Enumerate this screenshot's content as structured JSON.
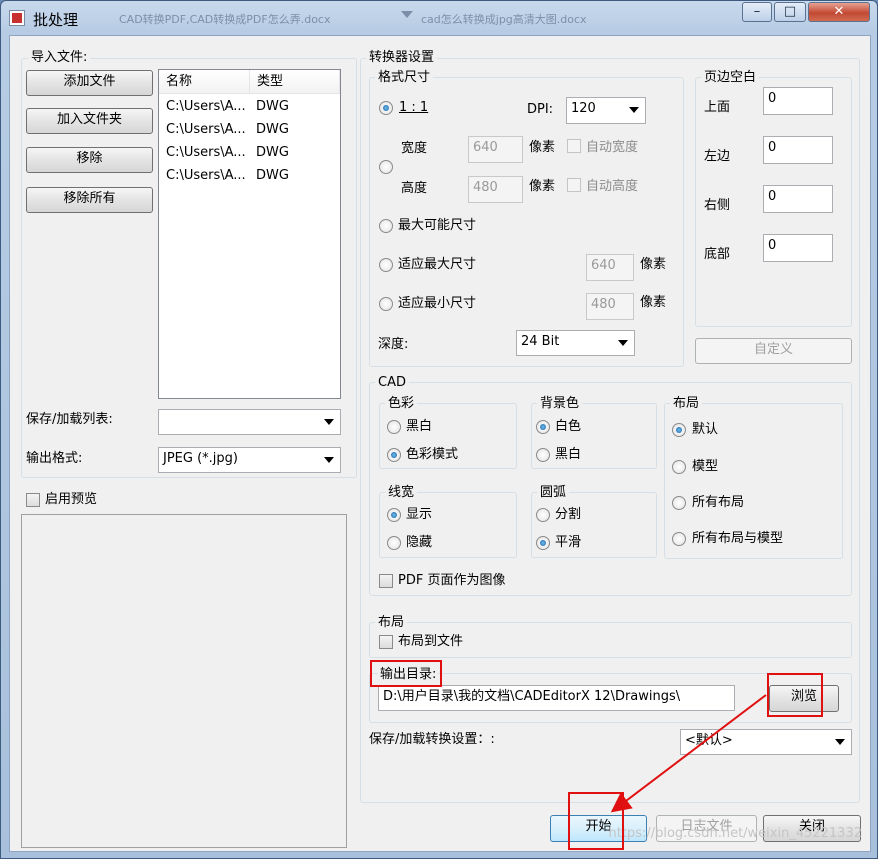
{
  "window": {
    "title": "批处理",
    "background_titles": [
      "CAD转换PDF,CAD转换成PDF怎么弄.docx",
      "cad怎么转换成jpg高清大图.docx"
    ],
    "controls": {
      "minimize": "–",
      "maximize": "□",
      "close": "✕"
    }
  },
  "import": {
    "group_title": "导入文件:",
    "buttons": {
      "add_file": "添加文件",
      "add_folder": "加入文件夹",
      "remove": "移除",
      "remove_all": "移除所有"
    },
    "columns": [
      "名称",
      "类型"
    ],
    "rows": [
      {
        "name": "C:\\Users\\A...",
        "type": "DWG"
      },
      {
        "name": "C:\\Users\\A...",
        "type": "DWG"
      },
      {
        "name": "C:\\Users\\A...",
        "type": "DWG"
      },
      {
        "name": "C:\\Users\\A...",
        "type": "DWG"
      }
    ],
    "save_load_label": "保存/加载列表:",
    "save_load_value": "",
    "output_format_label": "输出格式:",
    "output_format_value": "JPEG (*.jpg)"
  },
  "preview": {
    "enable_label": "启用预览",
    "checked": false
  },
  "converter": {
    "title": "转换器设置",
    "size": {
      "title": "格式尺寸",
      "ratio_label": "1 : 1",
      "dpi_label": "DPI:",
      "dpi_value": "120",
      "width_label": "宽度",
      "width_value": "640",
      "height_label": "高度",
      "height_value": "480",
      "pixel_unit": "像素",
      "auto_width": "自动宽度",
      "auto_height": "自动高度",
      "max_possible": "最大可能尺寸",
      "fit_max": "适应最大尺寸",
      "fit_max_value": "640",
      "fit_min": "适应最小尺寸",
      "fit_min_value": "480",
      "depth_label": "深度:",
      "depth_value": "24 Bit",
      "selected": "1 : 1"
    },
    "margins": {
      "title": "页边空白",
      "top_label": "上面",
      "top_value": "0",
      "left_label": "左边",
      "left_value": "0",
      "right_label": "右侧",
      "right_value": "0",
      "bottom_label": "底部",
      "bottom_value": "0",
      "custom_button": "自定义"
    },
    "cad": {
      "title": "CAD",
      "color": {
        "title": "色彩",
        "options": [
          "黑白",
          "色彩模式"
        ],
        "selected": "色彩模式"
      },
      "background": {
        "title": "背景色",
        "options": [
          "白色",
          "黑白"
        ],
        "selected": "白色"
      },
      "layout": {
        "title": "布局",
        "options": [
          "默认",
          "模型",
          "所有布局",
          "所有布局与模型"
        ],
        "selected": "默认"
      },
      "linewidth": {
        "title": "线宽",
        "options": [
          "显示",
          "隐藏"
        ],
        "selected": "显示"
      },
      "arc": {
        "title": "圆弧",
        "options": [
          "分割",
          "平滑"
        ],
        "selected": "平滑"
      },
      "pdf_as_image": "PDF 页面作为图像"
    },
    "layout_section": {
      "title": "布局",
      "to_file": "布局到文件"
    },
    "output": {
      "label": "输出目录:",
      "path": "D:\\用户目录\\我的文档\\CADEditorX 12\\Drawings\\",
      "browse": "浏览"
    },
    "save_load_settings_label": "保存/加载转换设置：:",
    "save_load_settings_value": "<默认>"
  },
  "footer": {
    "start": "开始",
    "log": "日志文件",
    "close": "关闭"
  },
  "watermark": "https://blog.csdn.net/weixin_45221332",
  "annotation_color": "#e01010"
}
